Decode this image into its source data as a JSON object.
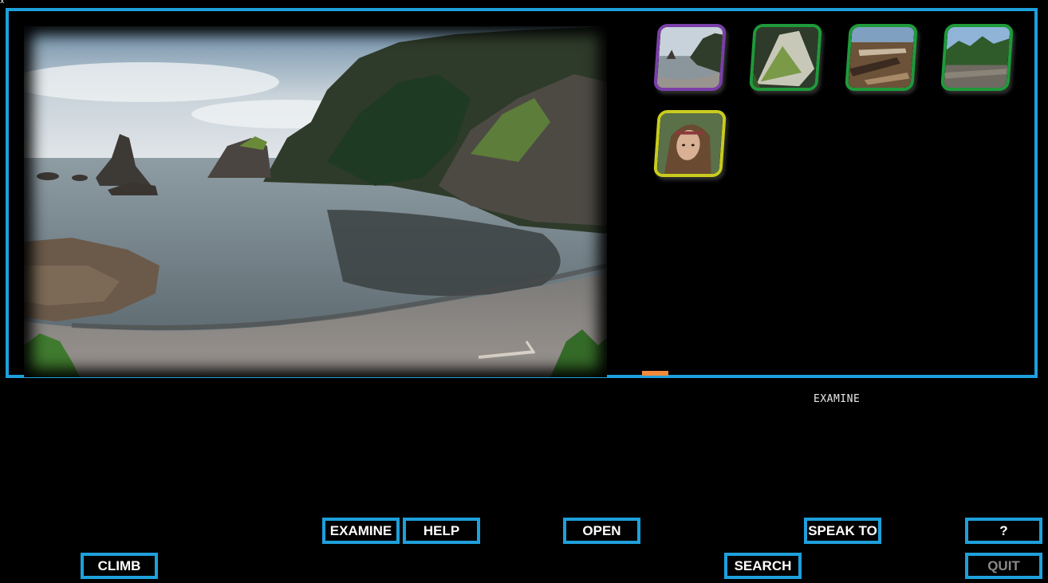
{
  "corner_mark": "x",
  "current_verb": "EXAMINE",
  "colors": {
    "frame": "#1ea0dc",
    "progress": "#f08a3a",
    "tile_purple": "#7a3fa8",
    "tile_green": "#1f9a3a",
    "tile_yellow": "#c9cc1e"
  },
  "inventory": [
    {
      "name": "cove-tile",
      "border": "#7a3fa8"
    },
    {
      "name": "tent-tile",
      "border": "#1f9a3a"
    },
    {
      "name": "driftwood-tile",
      "border": "#1f9a3a"
    },
    {
      "name": "forest-cliff-tile",
      "border": "#1f9a3a"
    },
    {
      "name": "girl-portrait-tile",
      "border": "#c9cc1e"
    }
  ],
  "commands": {
    "examine": "EXAMINE",
    "help": "HELP",
    "open": "OPEN",
    "speak_to": "SPEAK TO",
    "question": "?",
    "climb": "CLIMB",
    "search": "SEARCH",
    "quit": "QUIT"
  }
}
